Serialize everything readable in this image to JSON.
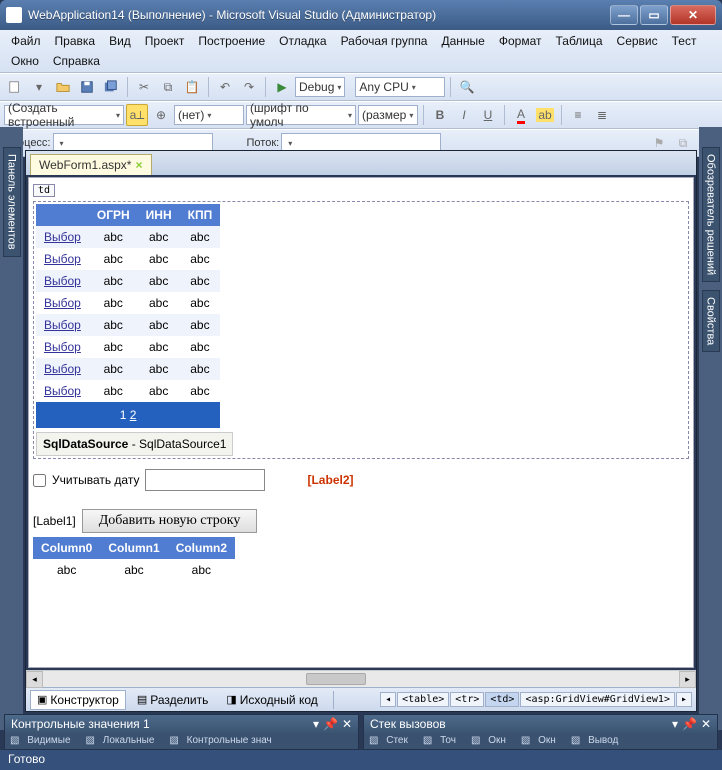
{
  "window": {
    "title": "WebApplication14 (Выполнение) - Microsoft Visual Studio (Администратор)",
    "btn_min": "—",
    "btn_max": "▭",
    "btn_close": "✕"
  },
  "menu": {
    "file": "Файл",
    "edit": "Правка",
    "view": "Вид",
    "project": "Проект",
    "build": "Построение",
    "debug": "Отладка",
    "team": "Рабочая группа",
    "data": "Данные",
    "format": "Формат",
    "table": "Таблица",
    "service": "Сервис",
    "test": "Тест",
    "window": "Окно",
    "help": "Справка"
  },
  "toolbar1": {
    "config": "Debug",
    "platform": "Any CPU"
  },
  "toolbar2": {
    "create": "(Создать встроенный",
    "style": "(нет)",
    "font": "(шрифт по умолч",
    "size": "(размер"
  },
  "toolbar3": {
    "process_lbl": "Процесс:",
    "thread_lbl": "Поток:"
  },
  "tabs": {
    "doc": "WebForm1.aspx*",
    "close": "×"
  },
  "crumb": "td",
  "gridview": {
    "headers": {
      "blank": "",
      "h1": "ОГРН",
      "h2": "ИНН",
      "h3": "КПП"
    },
    "select": "Выбор",
    "cell": "abc",
    "rows": 8,
    "pager": {
      "p1": "1",
      "p2": "2"
    }
  },
  "datasource": {
    "name": "SqlDataSource",
    "id": "SqlDataSource1",
    "dash": " - "
  },
  "form": {
    "check_label": "Учитывать дату",
    "label2": "[Label2]",
    "label1": "[Label1]",
    "add_btn": "Добавить новую строку"
  },
  "grid2": {
    "h0": "Column0",
    "h1": "Column1",
    "h2": "Column2",
    "cell": "abc"
  },
  "views": {
    "design": "Конструктор",
    "split": "Разделить",
    "source": "Исходный код"
  },
  "tagpath": {
    "t1": "<table>",
    "t2": "<tr>",
    "t3": "<td>",
    "t4": "<asp:GridView#GridView1>"
  },
  "left_panel": "Панель элементов",
  "right_panel1": "Обозреватель решений",
  "right_panel2": "Свойства",
  "bottom": {
    "pane1_title": "Контрольные значения 1",
    "pane2_title": "Стек вызовов",
    "p1_tabs": {
      "a": "Видимые",
      "b": "Локальные",
      "c": "Контрольные знач"
    },
    "p2_tabs": {
      "a": "Стек",
      "b": "Точ",
      "c": "Окн",
      "d": "Окн",
      "e": "Вывод"
    }
  },
  "status": "Готово"
}
